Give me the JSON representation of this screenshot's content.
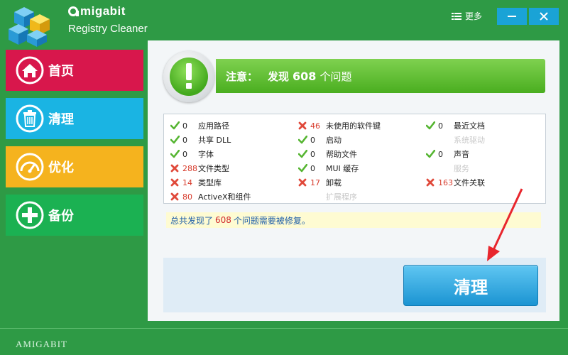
{
  "app": {
    "brand_name": "migabit",
    "product": "Registry Cleaner",
    "footer_brand": "AMIGABIT"
  },
  "header": {
    "more_label": "更多"
  },
  "sidebar": {
    "items": [
      {
        "label": "首页",
        "icon": "home-icon",
        "color": "#d8174c"
      },
      {
        "label": "清理",
        "icon": "trash-icon",
        "color": "#1ab4e3"
      },
      {
        "label": "优化",
        "icon": "gauge-icon",
        "color": "#f5b31e"
      },
      {
        "label": "备份",
        "icon": "plus-icon",
        "color": "#1bb152"
      }
    ]
  },
  "notice": {
    "prefix": "注意：",
    "found_text": "发现",
    "count": "608",
    "suffix": "个问题"
  },
  "results": {
    "columns": [
      [
        {
          "status": "ok",
          "count": "0",
          "label": "应用路径"
        },
        {
          "status": "ok",
          "count": "0",
          "label": "共享 DLL"
        },
        {
          "status": "ok",
          "count": "0",
          "label": "字体"
        },
        {
          "status": "error",
          "count": "288",
          "label": "文件类型"
        },
        {
          "status": "error",
          "count": "14",
          "label": "类型库"
        },
        {
          "status": "error",
          "count": "80",
          "label": "ActiveX和组件"
        }
      ],
      [
        {
          "status": "error",
          "count": "46",
          "label": "未使用的软件键"
        },
        {
          "status": "ok",
          "count": "0",
          "label": "启动"
        },
        {
          "status": "ok",
          "count": "0",
          "label": "帮助文件"
        },
        {
          "status": "ok",
          "count": "0",
          "label": "MUI 缓存"
        },
        {
          "status": "error",
          "count": "17",
          "label": "卸载"
        },
        {
          "status": "none",
          "count": "",
          "label": "扩展程序"
        }
      ],
      [
        {
          "status": "ok",
          "count": "0",
          "label": "最近文档"
        },
        {
          "status": "none",
          "count": "",
          "label": "系统驱动"
        },
        {
          "status": "ok",
          "count": "0",
          "label": "声音"
        },
        {
          "status": "none",
          "count": "",
          "label": "服务"
        },
        {
          "status": "error",
          "count": "163",
          "label": "文件关联"
        }
      ]
    ]
  },
  "summary": {
    "prefix": "总共发现了",
    "count": "608",
    "suffix": "个问题需要被修复。"
  },
  "actions": {
    "clean_label": "清理"
  },
  "colors": {
    "window_bg": "#2e9a45",
    "ok_check": "#55b531",
    "error_x": "#e0493a",
    "summary_count": "#d0272b",
    "clean_button": "#1b94d2"
  }
}
